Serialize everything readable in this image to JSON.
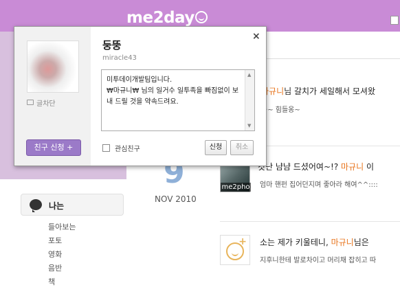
{
  "header": {
    "logo": "me2day"
  },
  "popup": {
    "name": "둥뚱",
    "username": "miracle43",
    "block_label": "글차단",
    "friend_request_label": "친구 신청 +",
    "message": "미투데이개발팀입니다.\n₩마규니₩ 님의 일거수 일투족을 빠짐없이 보내 드릴 것을 약속드려요.",
    "interest_friend_label": "관심친구",
    "apply_label": "신청",
    "cancel_label": "취소",
    "close_label": "×"
  },
  "sidebar": {
    "me_label": "나는",
    "items": [
      {
        "label": "들아보는"
      },
      {
        "label": "포토"
      },
      {
        "label": "영화"
      },
      {
        "label": "음반"
      },
      {
        "label": "책"
      }
    ]
  },
  "date": {
    "day": "9",
    "month_year": "NOV 2010"
  },
  "posts": [
    {
      "highlight": "마규니",
      "text": "님 갈치가 세일해서 모셔왔",
      "sub": "공~ 힘들옹~"
    },
    {
      "pre": "갓난 냠냠 드셨어여~!? ",
      "highlight": "마규니",
      "text": " 이",
      "sub": "엄마 핸펀 집어던지며 좋아라 해여^^::::"
    },
    {
      "pre": "소는 제가 키울테니, ",
      "highlight": "마규니",
      "text": "님은",
      "sub": "지후니한테 발로차이고 머리채 잡히고 따"
    }
  ],
  "avatar_label": "me2pho",
  "colors": {
    "topbar": "#c98bd6",
    "accent_purple": "#9b7ac8",
    "highlight_orange": "#e8731a",
    "date_blue": "#8fb0d8"
  }
}
